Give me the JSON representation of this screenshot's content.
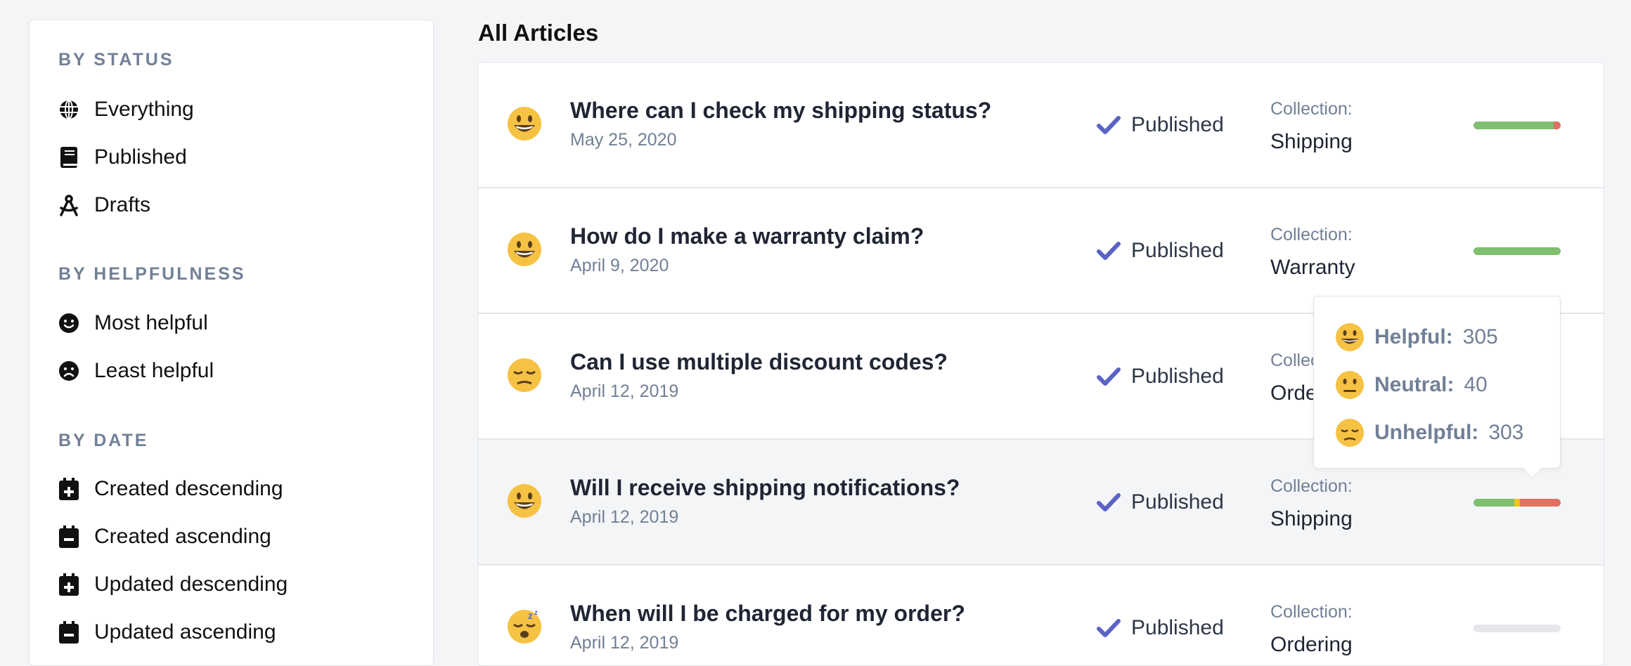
{
  "sidebar": {
    "status_title": "BY STATUS",
    "status_items": [
      {
        "label": "Everything",
        "icon": "globe-icon"
      },
      {
        "label": "Published",
        "icon": "book-icon"
      },
      {
        "label": "Drafts",
        "icon": "drafting-compass-icon"
      }
    ],
    "helpfulness_title": "BY HELPFULNESS",
    "helpfulness_items": [
      {
        "label": "Most helpful",
        "icon": "smile-icon"
      },
      {
        "label": "Least helpful",
        "icon": "frown-icon"
      }
    ],
    "date_title": "BY DATE",
    "date_items": [
      {
        "label": "Created descending",
        "icon": "calendar-plus-icon"
      },
      {
        "label": "Created ascending",
        "icon": "calendar-minus-icon"
      },
      {
        "label": "Updated descending",
        "icon": "calendar-plus-icon"
      },
      {
        "label": "Updated ascending",
        "icon": "calendar-minus-icon"
      }
    ]
  },
  "main": {
    "title": "All Articles",
    "collection_label": "Collection:",
    "articles": [
      {
        "emoji": "grinning-emoji-icon",
        "title": "Where can I check my shipping status?",
        "date": "May 25, 2020",
        "status": "Published",
        "collection": "Shipping",
        "helpful": 0.92,
        "neutral": 0.0,
        "unhelpful": 0.08
      },
      {
        "emoji": "grinning-emoji-icon",
        "title": "How do I make a warranty claim?",
        "date": "April 9, 2020",
        "status": "Published",
        "collection": "Warranty",
        "helpful": 1.0,
        "neutral": 0.0,
        "unhelpful": 0.0
      },
      {
        "emoji": "pensive-emoji-icon",
        "title": "Can I use multiple discount codes?",
        "date": "April 12, 2019",
        "status": "Published",
        "collection": "Orde",
        "helpful": 0.0,
        "neutral": 0.0,
        "unhelpful": 0.0
      },
      {
        "emoji": "grinning-emoji-icon",
        "title": "Will I receive shipping notifications?",
        "date": "April 12, 2019",
        "status": "Published",
        "collection": "Shipping",
        "helpful": 305,
        "neutral": 40,
        "unhelpful": 303
      },
      {
        "emoji": "sleeping-emoji-icon",
        "title": "When will I be charged for my order?",
        "date": "April 12, 2019",
        "status": "Published",
        "collection": "Ordering",
        "helpful": 0.0,
        "neutral": 0.0,
        "unhelpful": 0.0
      }
    ]
  },
  "tooltip": {
    "rows": [
      {
        "label": "Helpful:",
        "value": "305",
        "emoji": "grinning-emoji-icon"
      },
      {
        "label": "Neutral:",
        "value": "40",
        "emoji": "neutral-emoji-icon"
      },
      {
        "label": "Unhelpful:",
        "value": "303",
        "emoji": "pensive-emoji-icon"
      }
    ]
  },
  "colors": {
    "helpful": "#7fbf6f",
    "neutral": "#f0c419",
    "unhelpful": "#e07060",
    "accent": "#5a62c4",
    "empty": "#e5e7eb"
  }
}
